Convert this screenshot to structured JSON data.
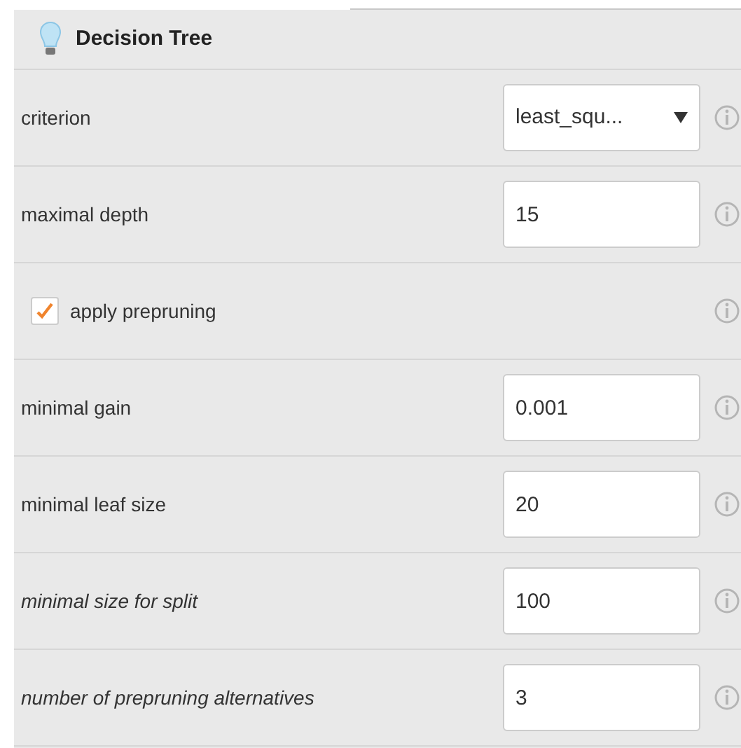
{
  "panel": {
    "title": "Decision Tree"
  },
  "parameters": [
    {
      "kind": "select",
      "label": "criterion",
      "value": "least_squ...",
      "expert": false
    },
    {
      "kind": "number",
      "label": "maximal depth",
      "value": "15",
      "expert": false
    },
    {
      "kind": "checkbox",
      "label": "apply prepruning",
      "checked": true,
      "expert": false
    },
    {
      "kind": "number",
      "label": "minimal gain",
      "value": "0.001",
      "expert": false
    },
    {
      "kind": "number",
      "label": "minimal leaf size",
      "value": "20",
      "expert": false
    },
    {
      "kind": "number",
      "label": "minimal size for split",
      "value": "100",
      "expert": true
    },
    {
      "kind": "number",
      "label": "number of prepruning alternatives",
      "value": "3",
      "expert": true
    }
  ]
}
